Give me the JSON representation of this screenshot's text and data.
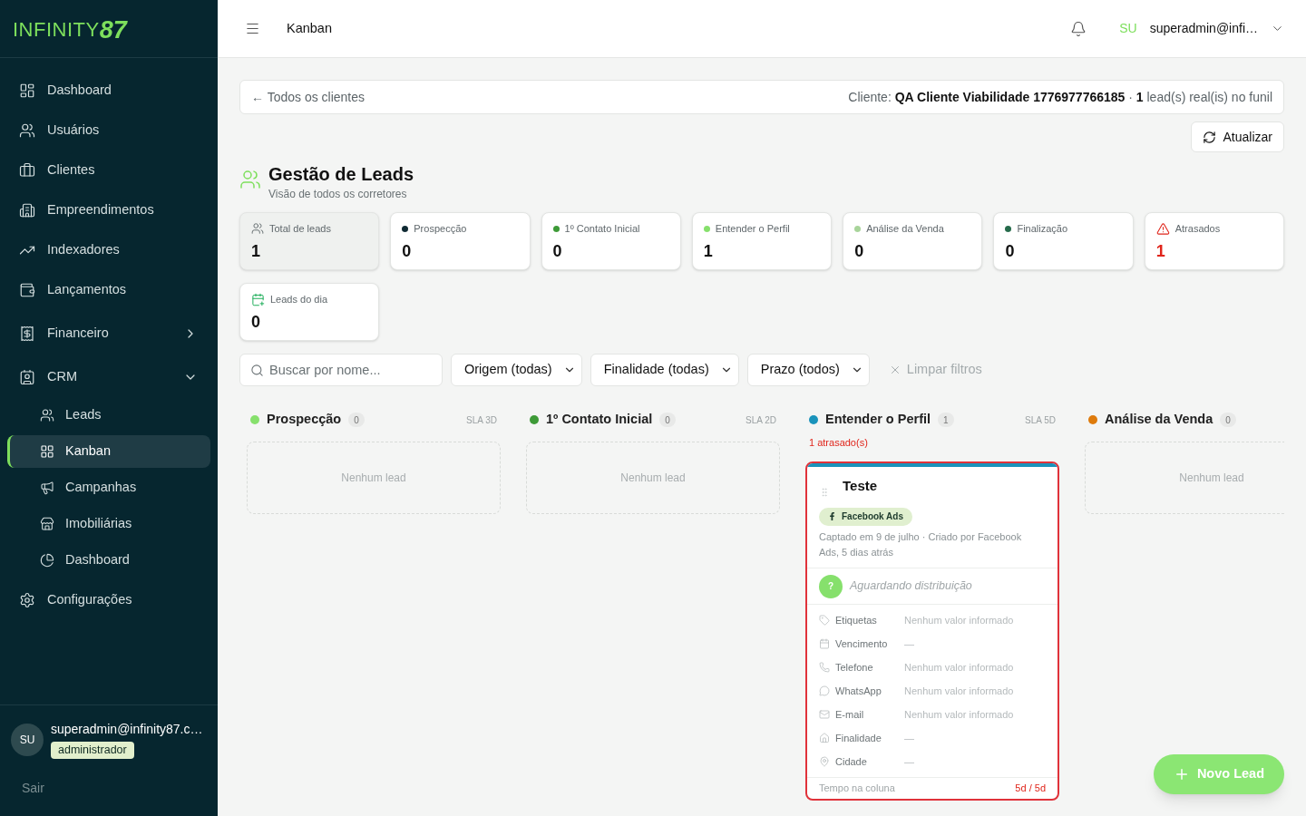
{
  "sidebar": {
    "logo": {
      "wordmark": "INFINITY",
      "numeral": "87"
    },
    "nav": [
      {
        "kind": "link",
        "label": "Dashboard",
        "selected": false
      },
      {
        "kind": "link",
        "label": "Usuários",
        "selected": false
      },
      {
        "kind": "link",
        "label": "Clientes",
        "selected": false
      },
      {
        "kind": "link",
        "label": "Empreendimentos",
        "selected": false
      },
      {
        "kind": "link",
        "label": "Indexadores",
        "selected": false
      },
      {
        "kind": "link",
        "label": "Lançamentos",
        "selected": false
      },
      {
        "kind": "group",
        "label": "Financeiro",
        "selected": false,
        "expanded": false
      },
      {
        "kind": "group",
        "label": "CRM",
        "selected": false,
        "expanded": true,
        "children": [
          {
            "label": "Leads",
            "selected": false
          },
          {
            "label": "Kanban",
            "selected": true
          },
          {
            "label": "Campanhas",
            "selected": false
          },
          {
            "label": "Imobiliárias",
            "selected": false
          },
          {
            "label": "Dashboard",
            "selected": false
          }
        ]
      },
      {
        "kind": "link",
        "label": "Configurações",
        "selected": false
      }
    ],
    "user": {
      "initials": "SU",
      "email": "superadmin@infinity87.c…",
      "role": "administrador"
    },
    "logout": "Sair"
  },
  "topbar": {
    "title": "Kanban",
    "user": {
      "initials": "SU",
      "email": "superadmin@infi…"
    }
  },
  "client_bar": {
    "back": "← Todos os clientes",
    "summary": "Cliente: **QA Cliente Viabilidade 1776977766185** · **1** lead(s) real(is) no funil"
  },
  "refresh_button": "Atualizar",
  "header": {
    "title": "Gestão de Leads",
    "subtitle": "Visão de todos os corretores"
  },
  "stats": [
    {
      "kind": "total",
      "label": "Total de leads",
      "value": "1",
      "selected": true
    },
    {
      "kind": "stage",
      "label": "Prospecção",
      "value": "0",
      "color": "#0f2a33",
      "selected": false
    },
    {
      "kind": "stage",
      "label": "1º Contato Inicial",
      "value": "0",
      "color": "#3d9a37",
      "selected": false
    },
    {
      "kind": "stage",
      "label": "Entender o Perfil",
      "value": "1",
      "color": "#86e06c",
      "selected": false
    },
    {
      "kind": "stage",
      "label": "Análise da Venda",
      "value": "0",
      "color": "#a8d49a",
      "selected": false
    },
    {
      "kind": "stage",
      "label": "Finalização",
      "value": "0",
      "color": "#266b4b",
      "selected": false
    },
    {
      "kind": "alert",
      "label": "Atrasados",
      "value": "1",
      "selected": false
    },
    {
      "kind": "today",
      "label": "Leads do dia",
      "value": "0",
      "selected": false
    }
  ],
  "filters": {
    "search": {
      "placeholder": "Buscar por nome..."
    },
    "selects": [
      {
        "value": "Origem (todas)"
      },
      {
        "value": "Finalidade (todas)"
      },
      {
        "value": "Prazo (todos)"
      }
    ],
    "clear": {
      "label": "Limpar filtros",
      "disabled": true
    }
  },
  "board": {
    "columns": [
      {
        "title": "Prospecção",
        "count": "0",
        "sla": "SLA 3D",
        "color": "#86e06c",
        "empty_text": "Nenhum lead"
      },
      {
        "title": "1º Contato Inicial",
        "count": "0",
        "sla": "SLA 2D",
        "color": "#3d9a37",
        "empty_text": "Nenhum lead"
      },
      {
        "title": "Entender o Perfil",
        "count": "1",
        "sla": "SLA 5D",
        "color": "#1a93bb",
        "late_note": "1 atrasado(s)",
        "cards": [
          {
            "name": "Teste",
            "overdue": true,
            "source": "Facebook Ads",
            "meta": "Captado em 9 de julho · Criado por Facebook Ads, 5 dias atrás",
            "assignee": {
              "initial": "?",
              "label": "Aguardando distribuição"
            },
            "fields": [
              {
                "label": "Etiquetas",
                "value": "Nenhum valor informado"
              },
              {
                "label": "Vencimento",
                "value": "—"
              },
              {
                "label": "Telefone",
                "value": "Nenhum valor informado"
              },
              {
                "label": "WhatsApp",
                "value": "Nenhum valor informado"
              },
              {
                "label": "E-mail",
                "value": "Nenhum valor informado"
              },
              {
                "label": "Finalidade",
                "value": "—"
              },
              {
                "label": "Cidade",
                "value": "—"
              }
            ],
            "time": {
              "label": "Tempo na coluna",
              "value": "5d / 5d"
            }
          }
        ]
      },
      {
        "title": "Análise da Venda",
        "count": "0",
        "color": "#de7b0c",
        "empty_text": "Nenhum lead"
      }
    ]
  },
  "fab": {
    "label": "Novo Lead"
  }
}
